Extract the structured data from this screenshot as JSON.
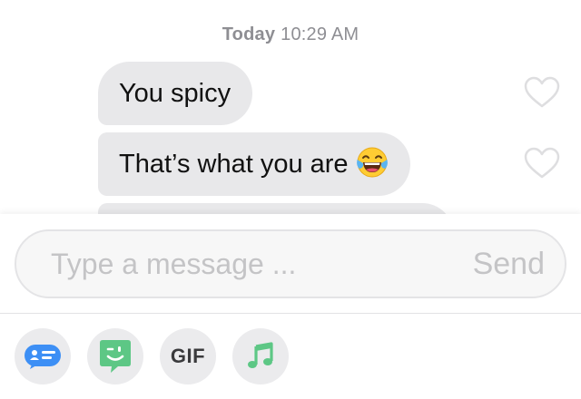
{
  "timestamp": {
    "day": "Today",
    "time": "10:29 AM"
  },
  "messages": [
    {
      "text": "You spicy",
      "liked": false
    },
    {
      "text": "That’s what you are",
      "emoji": "face-with-tears-of-joy",
      "liked": false
    },
    {
      "text": "",
      "liked": false
    }
  ],
  "composer": {
    "placeholder": "Type a message ...",
    "value": "",
    "send_label": "Send"
  },
  "toolbar": {
    "items": [
      {
        "icon": "contact-card-icon",
        "color": "#3d8ff5"
      },
      {
        "icon": "winking-sticker-icon",
        "color": "#5dc785"
      },
      {
        "label": "GIF",
        "icon": "gif-icon"
      },
      {
        "icon": "music-note-icon",
        "color": "#5dc785"
      }
    ]
  },
  "colors": {
    "bubble_incoming": "#e8e8ea",
    "placeholder": "#c4c4c6",
    "accent_blue": "#3d8ff5",
    "accent_green": "#5dc785"
  }
}
